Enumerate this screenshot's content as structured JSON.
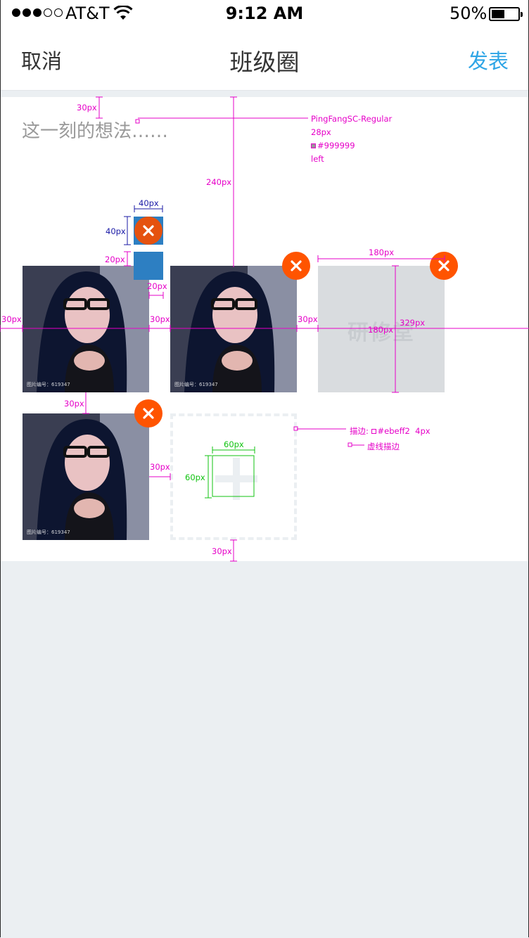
{
  "status_bar": {
    "signal_dots": [
      true,
      true,
      true,
      false,
      false
    ],
    "carrier": "AT&T",
    "time": "9:12 AM",
    "battery_text": "50%",
    "battery_level": 0.5
  },
  "nav": {
    "cancel_label": "取消",
    "title": "班级圈",
    "publish_label": "发表",
    "publish_color": "#2ea5e6"
  },
  "compose": {
    "placeholder": "这一刻的想法……",
    "photos": [
      {
        "watermark": "图片编号：619347"
      },
      {
        "watermark": "图片编号：619347"
      },
      {
        "watermark": "图片编号：619347"
      }
    ],
    "placeholder_image_text": "研修堂",
    "delete_icon_color": "#ff5400",
    "add_icon": "plus-icon"
  },
  "annotations": {
    "font_name": "PingFangSC-Regular",
    "font_size": "28px",
    "font_color": "#999999",
    "align": "left",
    "stroke_note": "描边:",
    "stroke_color": "#ebeff2",
    "stroke_width": "4px",
    "dashed_note": "虚线描边",
    "m30": "30px",
    "m240": "240px",
    "m40": "40px",
    "m20": "20px",
    "m180": "180px",
    "m329": "329px",
    "m60": "60px"
  }
}
